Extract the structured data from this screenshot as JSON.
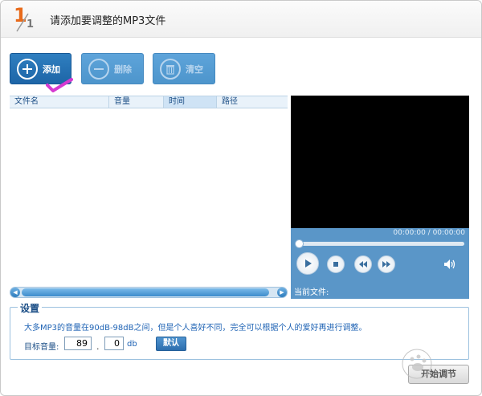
{
  "header": {
    "step_current": "1",
    "step_total": "1",
    "title": "请添加要调整的MP3文件"
  },
  "toolbar": {
    "add_label": "添加",
    "delete_label": "删除",
    "clear_label": "清空"
  },
  "file_list": {
    "columns": [
      "文件名",
      "音量",
      "时间",
      "路径"
    ],
    "rows": []
  },
  "player": {
    "time_display": "00:00:00 / 00:00:00",
    "progress": 0,
    "current_file_label": "当前文件:"
  },
  "settings": {
    "legend": "设置",
    "description": "大多MP3的音量在90dB-98dB之间，但是个人喜好不同，完全可以根据个人的爱好再进行调整。",
    "target_label": "目标音量:",
    "value_int": "89",
    "separator": ".",
    "value_dec": "0",
    "unit": "db",
    "default_button": "默认"
  },
  "footer": {
    "start_button": "开始调节"
  },
  "colors": {
    "accent": "#1d65a7",
    "step_number": "#e86a1a",
    "check_mark": "#d63ad1"
  }
}
